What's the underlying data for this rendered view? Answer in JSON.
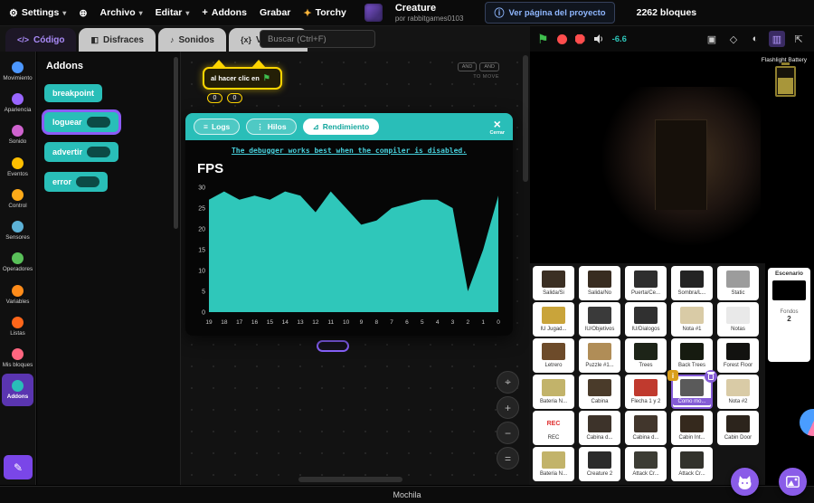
{
  "menu": {
    "settings": "Settings",
    "archivo": "Archivo",
    "editar": "Editar",
    "addons": "Addons",
    "grabar": "Grabar",
    "torchy": "Torchy",
    "project_title": "Creature",
    "project_author": "por rabbitgames0103",
    "view_project": "Ver página del proyecto",
    "blocks_count": "2262 bloques"
  },
  "tabs": [
    {
      "label": "Código",
      "icon": "code-icon",
      "active": true
    },
    {
      "label": "Disfraces",
      "icon": "costumes-icon",
      "active": false
    },
    {
      "label": "Sonidos",
      "icon": "sounds-icon",
      "active": false
    },
    {
      "label": "Variables",
      "icon": "variables-icon",
      "active": false
    }
  ],
  "search": {
    "placeholder": "Buscar (Ctrl+F)"
  },
  "stage_controls": {
    "volume_value": "-6.6"
  },
  "categories": [
    {
      "label": "Movimiento",
      "color": "#4C97FF",
      "active": false
    },
    {
      "label": "Apariencia",
      "color": "#9966FF",
      "active": false
    },
    {
      "label": "Sonido",
      "color": "#CF63CF",
      "active": false
    },
    {
      "label": "Eventos",
      "color": "#FFBF00",
      "active": false
    },
    {
      "label": "Control",
      "color": "#FFAB19",
      "active": false
    },
    {
      "label": "Sensores",
      "color": "#5CB1D6",
      "active": false
    },
    {
      "label": "Operadores",
      "color": "#59C059",
      "active": false
    },
    {
      "label": "Variables",
      "color": "#FF8C1A",
      "active": false
    },
    {
      "label": "Listas",
      "color": "#FF661A",
      "active": false
    },
    {
      "label": "Mis bloques",
      "color": "#FF6680",
      "active": false
    },
    {
      "label": "Addons",
      "color": "#29beb8",
      "active": true
    }
  ],
  "palette": {
    "header": "Addons",
    "blocks": [
      {
        "label": "breakpoint",
        "input": false,
        "highlight": false
      },
      {
        "label": "loguear",
        "input": true,
        "highlight": true
      },
      {
        "label": "advertir",
        "input": true,
        "highlight": false
      },
      {
        "label": "error",
        "input": true,
        "highlight": false
      }
    ]
  },
  "workspace": {
    "hat_block_label": "al hacer clic en",
    "hat_values": [
      "0",
      "0"
    ],
    "ghost_chip": "AND",
    "ghost_text": "TO MOVE"
  },
  "debugger": {
    "tabs": [
      {
        "label": "Logs",
        "icon": "logs-icon",
        "active": false
      },
      {
        "label": "Hilos",
        "icon": "threads-icon",
        "active": false
      },
      {
        "label": "Rendimiento",
        "icon": "performance-icon",
        "active": true
      }
    ],
    "close_label": "Cerrar",
    "notice": "The debugger works best when the compiler is disabled.",
    "chart_title": "FPS"
  },
  "chart_data": {
    "type": "area",
    "title": "FPS",
    "x": [
      19,
      18,
      17,
      16,
      15,
      14,
      13,
      12,
      11,
      10,
      9,
      8,
      7,
      6,
      5,
      4,
      3,
      2,
      1,
      0
    ],
    "values": [
      27,
      29,
      27,
      28,
      27,
      29,
      28,
      24,
      29,
      25,
      21,
      22,
      25,
      26,
      27,
      27,
      25,
      5,
      15,
      28
    ],
    "ylim": [
      0,
      30
    ],
    "yticks": [
      0,
      5,
      10,
      15,
      20,
      25,
      30
    ],
    "xlabel": "",
    "ylabel": "",
    "grid": false,
    "legend": "none",
    "fill_color": "#2fc7ba",
    "background": "#060606"
  },
  "sprites": [
    {
      "name": "Salida/Si",
      "thumb": "#3b2f23",
      "selected": false
    },
    {
      "name": "Salida/No",
      "thumb": "#382c20",
      "selected": false
    },
    {
      "name": "Puerta/Ce...",
      "thumb": "#2e2e2e",
      "selected": false
    },
    {
      "name": "Sombra/L...",
      "thumb": "#232323",
      "selected": false
    },
    {
      "name": "Static",
      "thumb": "#9c9c9c",
      "selected": false
    },
    {
      "name": "IU Jugad...",
      "thumb": "#c9a43a",
      "selected": false
    },
    {
      "name": "IU/Objetivos",
      "thumb": "#3a3a3a",
      "selected": false
    },
    {
      "name": "IU/Dialogos",
      "thumb": "#303030",
      "selected": false
    },
    {
      "name": "Nota #1",
      "thumb": "#d9cba6",
      "selected": false
    },
    {
      "name": "Notas",
      "thumb": "#e9e9e9",
      "selected": false
    },
    {
      "name": "Letrero",
      "thumb": "#6d4b2a",
      "selected": false
    },
    {
      "name": "Puzzle #1...",
      "thumb": "#b08d57",
      "selected": false
    },
    {
      "name": "Trees",
      "thumb": "#1d2418",
      "selected": false
    },
    {
      "name": "Back Trees",
      "thumb": "#161b10",
      "selected": false
    },
    {
      "name": "Forest Floor",
      "thumb": "#121210",
      "selected": false
    },
    {
      "name": "Bateria N...",
      "thumb": "#c2b36a",
      "selected": false
    },
    {
      "name": "Cabina",
      "thumb": "#4a3b2a",
      "selected": false
    },
    {
      "name": "Flecha 1 y 2",
      "thumb": "#c03a2e",
      "selected": false
    },
    {
      "name": "Como mo...",
      "thumb": "#5a5a5a",
      "selected": true
    },
    {
      "name": "Nota #2",
      "thumb": "#d9cba6",
      "selected": false
    },
    {
      "name": "REC",
      "thumb": "#ffffff",
      "text": "REC",
      "text_color": "#e03030",
      "selected": false
    },
    {
      "name": "Cabina d...",
      "thumb": "#3d332a",
      "selected": false
    },
    {
      "name": "Cabina d...",
      "thumb": "#41362c",
      "selected": false
    },
    {
      "name": "Cabin Int...",
      "thumb": "#35291d",
      "selected": false
    },
    {
      "name": "Cabin Door",
      "thumb": "#2c241c",
      "selected": false
    },
    {
      "name": "Bateria N...",
      "thumb": "#c2b36a",
      "selected": false
    },
    {
      "name": "Creature 2",
      "thumb": "#2b2b2b",
      "selected": false
    },
    {
      "name": "Attack Cr...",
      "thumb": "#3c3c34",
      "selected": false
    },
    {
      "name": "Attack Cr...",
      "thumb": "#32322c",
      "selected": false
    }
  ],
  "stage_panel": {
    "title": "Escenario",
    "fondos_label": "Fondos",
    "fondos_count": "2"
  },
  "hud": {
    "flashlight_label": "Flashlight Battery"
  },
  "backpack": {
    "label": "Mochila"
  },
  "colors": {
    "accent_purple": "#855cd6",
    "debugger_teal": "#29beb8",
    "flag_green": "#3fbf4e",
    "stop_red": "#ff4d4d"
  }
}
